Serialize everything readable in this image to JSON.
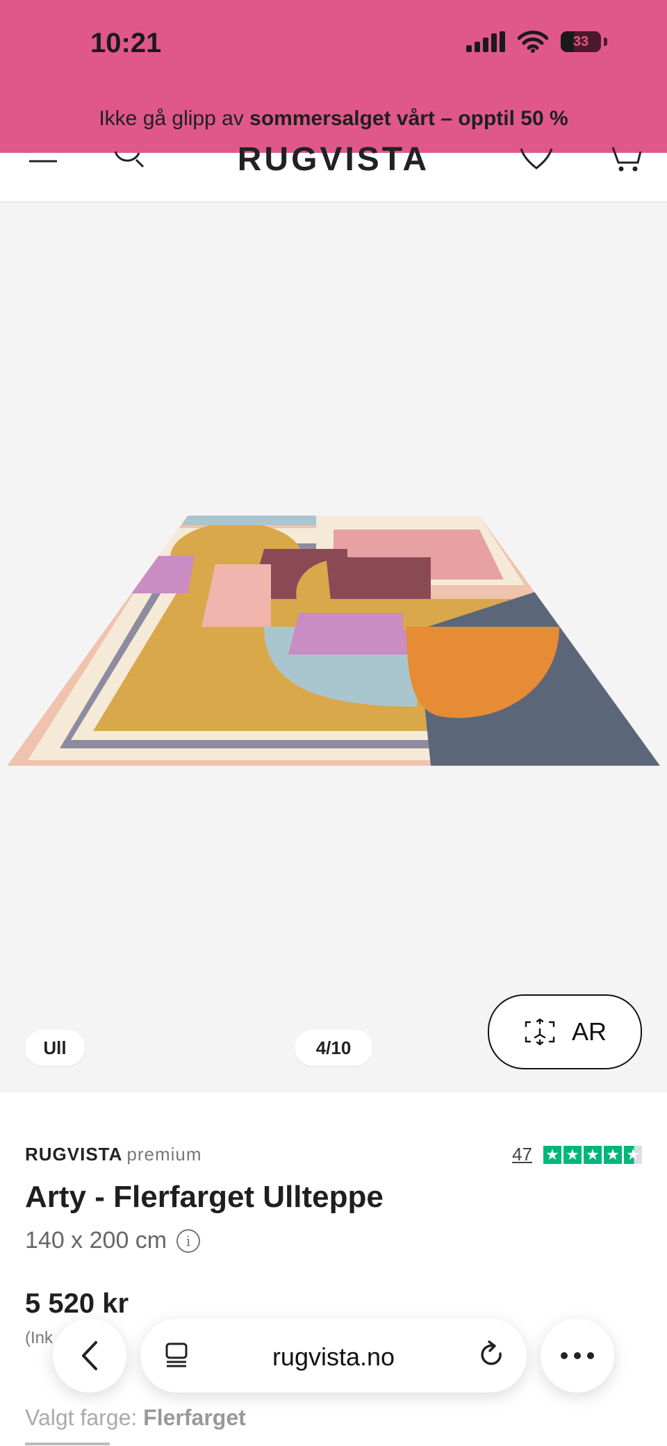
{
  "status_bar": {
    "time": "10:21",
    "battery": "33",
    "battery_level": 0.33
  },
  "promo": {
    "text_regular": "Ikke gå glipp av ",
    "text_bold": "sommersalget vårt – opptil 50 %"
  },
  "header": {
    "logo": "RUGVISTA"
  },
  "gallery": {
    "material_badge": "Ull",
    "counter": "4/10",
    "ar_label": "AR"
  },
  "product": {
    "brand": "RUGVISTA",
    "brand_line": "premium",
    "review_count": "47",
    "rating_stars": 4.5,
    "title": "Arty - Flerfarget Ullteppe",
    "size": "140 x 200 cm",
    "price": "5 520 kr",
    "vat_note": "(Ink      a)",
    "color_label": "Valgt farge: ",
    "color_value": "Flerfarget"
  },
  "browser": {
    "url": "rugvista.no"
  },
  "colors": {
    "banner": "#e0588a",
    "trustpilot": "#00b67a",
    "gallery_bg": "#f4f4f4"
  }
}
